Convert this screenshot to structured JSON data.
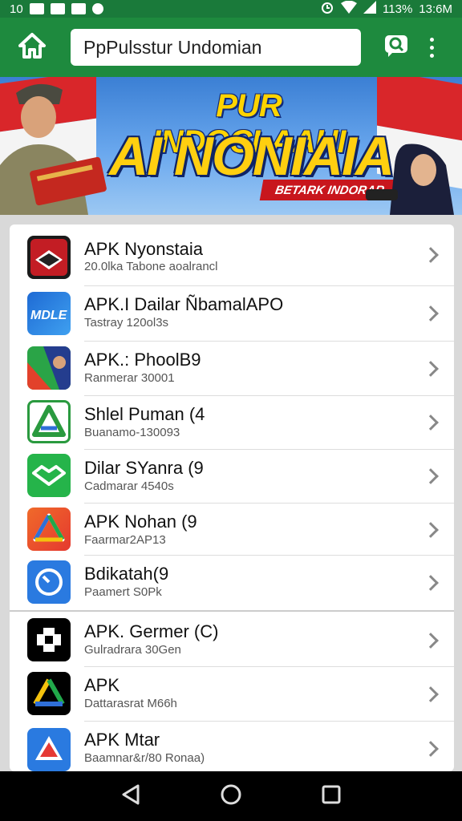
{
  "status_bar": {
    "left_text": "10",
    "battery": "113%",
    "time": "13:6M"
  },
  "app_bar": {
    "search_value": "PpPulsstur Undomian"
  },
  "banner": {
    "title_line1": "PUR INDOCLAAHI",
    "title_line2": "AI NONIAIA",
    "ribbon": "BETARK INDORAR"
  },
  "apps": [
    {
      "title": "APK Nyonstaia",
      "subtitle": "20.0lka Tabone aoalrancl",
      "icon": "book-icon"
    },
    {
      "title": "APK.I Dailar ÑbamalAPO",
      "subtitle": "Tastray 120ol3s",
      "icon": "mdle-icon"
    },
    {
      "title": "APK.: PhoolB9",
      "subtitle": "Ranmerar 30001",
      "icon": "poster-icon"
    },
    {
      "title": "Shlel Puman (4",
      "subtitle": "Buanamo-130093",
      "icon": "drive-outline-icon"
    },
    {
      "title": "Dilar SYanra (9",
      "subtitle": "Cadmarar 4540s",
      "icon": "handshake-icon"
    },
    {
      "title": "APK Nohan (9",
      "subtitle": "Faarmar2AP13",
      "icon": "drive-icon"
    },
    {
      "title": "Bdikatah(9",
      "subtitle": "Paamert S0Pk",
      "icon": "gauge-icon"
    },
    {
      "title": "APK. Germer (C)",
      "subtitle": "Gulradrara 30Gen",
      "icon": "plus-icon"
    },
    {
      "title": "APK",
      "subtitle": "Dattarasrat M66h",
      "icon": "drive-dark-icon"
    },
    {
      "title": "APK Mtar",
      "subtitle": "Baamnar&r/80 Ronaa)",
      "icon": "drive-blue-icon"
    }
  ],
  "colors": {
    "app_bar": "#1e8a3e",
    "status_bar": "#1a7a3a"
  }
}
